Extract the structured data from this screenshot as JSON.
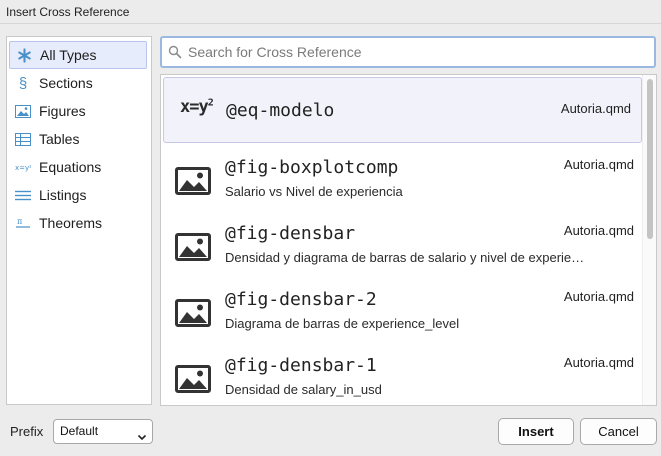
{
  "window": {
    "title": "Insert Cross Reference"
  },
  "sidebar": {
    "items": [
      {
        "label": "All Types",
        "icon": "asterisk-icon",
        "selected": true
      },
      {
        "label": "Sections",
        "icon": "section-icon",
        "selected": false
      },
      {
        "label": "Figures",
        "icon": "image-icon",
        "selected": false
      },
      {
        "label": "Tables",
        "icon": "table-icon",
        "selected": false
      },
      {
        "label": "Equations",
        "icon": "equation-icon",
        "selected": false
      },
      {
        "label": "Listings",
        "icon": "listing-icon",
        "selected": false
      },
      {
        "label": "Theorems",
        "icon": "theorem-icon",
        "selected": false
      }
    ]
  },
  "search": {
    "placeholder": "Search for Cross Reference",
    "value": ""
  },
  "results": [
    {
      "type": "equation",
      "label": "@eq-modelo",
      "caption": "",
      "file": "Autoria.qmd",
      "selected": true
    },
    {
      "type": "figure",
      "label": "@fig-boxplotcomp",
      "caption": "Salario vs Nivel de experiencia",
      "file": "Autoria.qmd",
      "selected": false
    },
    {
      "type": "figure",
      "label": "@fig-densbar",
      "caption": "Densidad y diagrama de barras de salario y nivel de experie…",
      "file": "Autoria.qmd",
      "selected": false
    },
    {
      "type": "figure",
      "label": "@fig-densbar-2",
      "caption": "Diagrama de barras de experience_level",
      "file": "Autoria.qmd",
      "selected": false
    },
    {
      "type": "figure",
      "label": "@fig-densbar-1",
      "caption": "Densidad de salary_in_usd",
      "file": "Autoria.qmd",
      "selected": false
    }
  ],
  "eq_glyph": {
    "base": "x=y",
    "sup": "2"
  },
  "footer": {
    "prefix_label": "Prefix",
    "prefix_value": "Default",
    "insert_label": "Insert",
    "cancel_label": "Cancel"
  },
  "colors": {
    "accent": "#4a90c8",
    "selection": "#e6ecfb",
    "focus_border": "#9ab9e0"
  }
}
